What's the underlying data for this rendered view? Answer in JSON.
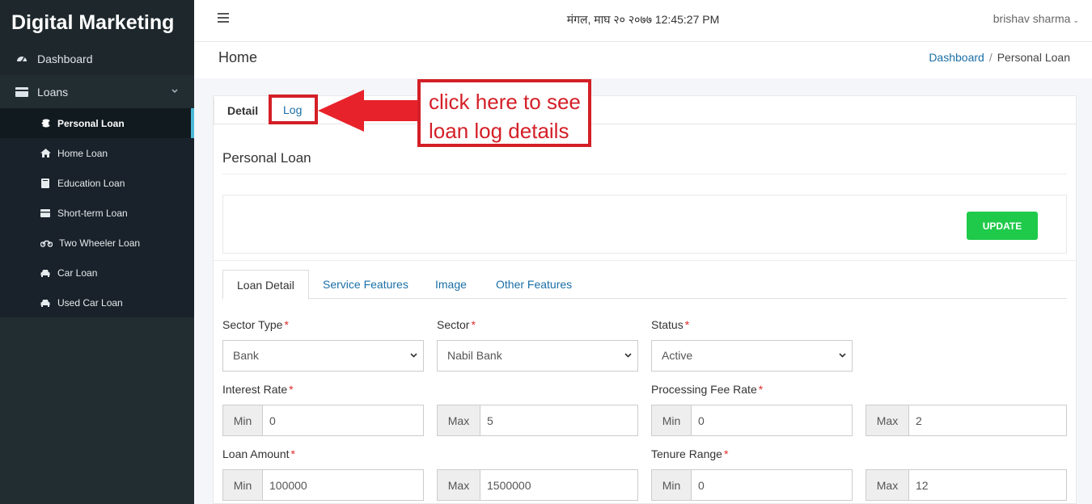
{
  "sidebar": {
    "brand": "Digital Marketing",
    "top_items": [
      {
        "label": "Dashboard",
        "icon": "dashboard-gauge-icon"
      },
      {
        "label": "Loans",
        "icon": "credit-card-icon"
      }
    ],
    "sub_items": [
      {
        "label": "Personal Loan",
        "icon": "coins-icon",
        "active": true
      },
      {
        "label": "Home Loan",
        "icon": "home-icon"
      },
      {
        "label": "Education Loan",
        "icon": "book-icon"
      },
      {
        "label": "Short-term Loan",
        "icon": "wallet-icon"
      },
      {
        "label": "Two Wheeler Loan",
        "icon": "motorcycle-icon"
      },
      {
        "label": "Car Loan",
        "icon": "car-icon"
      },
      {
        "label": "Used Car Loan",
        "icon": "car-icon"
      }
    ]
  },
  "header": {
    "datetime": "मंगल, माघ २० २०७७ 12:45:27 PM",
    "user": "brishav sharma"
  },
  "page": {
    "title": "Home",
    "breadcrumb_link": "Dashboard",
    "breadcrumb_current": "Personal Loan"
  },
  "card": {
    "tabs": [
      "Detail",
      "Log"
    ],
    "title": "Personal Loan",
    "update_label": "UPDATE",
    "inner_tabs": [
      "Loan Detail",
      "Service Features",
      "Image",
      "Other Features"
    ]
  },
  "form": {
    "sector_type": {
      "label": "Sector Type",
      "value": "Bank"
    },
    "sector": {
      "label": "Sector",
      "value": "Nabil Bank"
    },
    "status": {
      "label": "Status",
      "value": "Active"
    },
    "interest_rate": {
      "label": "Interest Rate",
      "min_label": "Min",
      "min": "0",
      "max_label": "Max",
      "max": "5"
    },
    "processing_fee_rate": {
      "label": "Processing Fee Rate",
      "min_label": "Min",
      "min": "0",
      "max_label": "Max",
      "max": "2"
    },
    "loan_amount": {
      "label": "Loan Amount",
      "min_label": "Min",
      "min": "100000",
      "max_label": "Max",
      "max": "1500000"
    },
    "tenure_range": {
      "label": "Tenure Range",
      "min_label": "Min",
      "min": "0",
      "max_label": "Max",
      "max": "12"
    },
    "required_mark": "*"
  },
  "annotation": {
    "line1": "click here to see",
    "line2": "loan log details",
    "color": "#d41f27"
  },
  "colors": {
    "sidebar_bg": "#222d32",
    "link": "#1a6fa6",
    "update_button": "#1fca4a",
    "active_marker": "#4db8d6"
  }
}
